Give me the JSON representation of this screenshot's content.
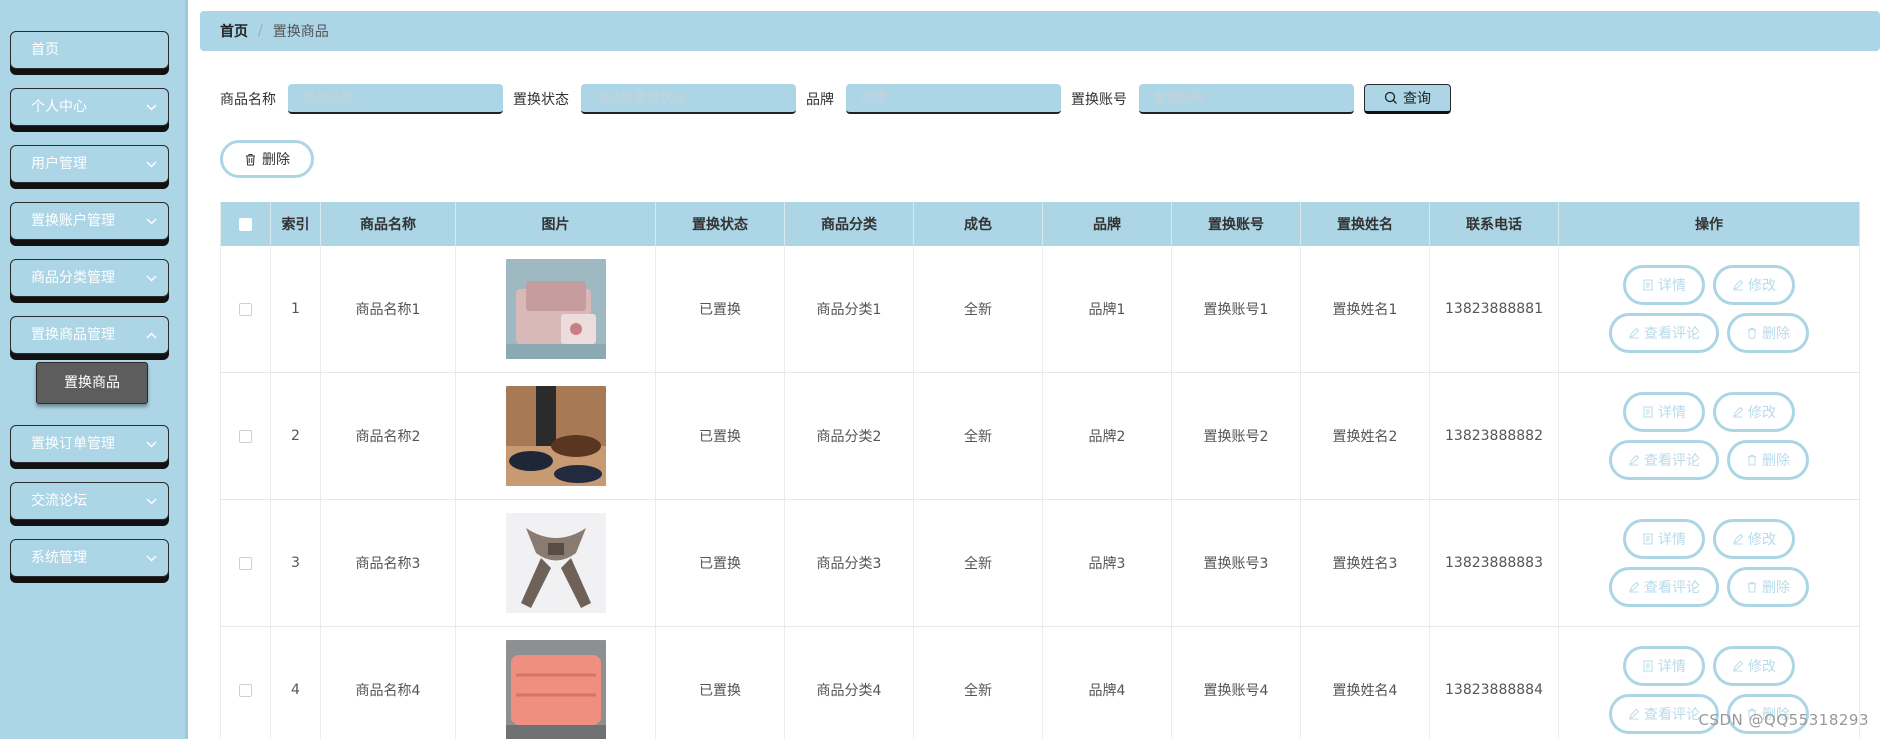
{
  "sidebar": {
    "items": [
      {
        "label": "首页"
      },
      {
        "label": "个人中心"
      },
      {
        "label": "用户管理"
      },
      {
        "label": "置换账户管理"
      },
      {
        "label": "商品分类管理"
      },
      {
        "label": "置换商品管理"
      },
      {
        "label": "置换订单管理"
      },
      {
        "label": "交流论坛"
      },
      {
        "label": "系统管理"
      }
    ],
    "sub_item": "置换商品"
  },
  "breadcrumb": {
    "home": "首页",
    "separator": "/",
    "current": "置换商品"
  },
  "search": {
    "name_label": "商品名称",
    "name_placeholder": "商品名称",
    "status_label": "置换状态",
    "status_placeholder": "请选择置换状态",
    "brand_label": "品牌",
    "brand_placeholder": "品牌",
    "account_label": "置换账号",
    "account_placeholder": "置换账号",
    "query_label": "查询"
  },
  "toolbar": {
    "delete_label": "删除"
  },
  "table": {
    "headers": {
      "index": "索引",
      "name": "商品名称",
      "image": "图片",
      "status": "置换状态",
      "category": "商品分类",
      "condition": "成色",
      "brand": "品牌",
      "account": "置换账号",
      "owner": "置换姓名",
      "phone": "联系电话",
      "actions": "操作"
    },
    "actions": {
      "detail": "详情",
      "edit": "修改",
      "review": "查看评论",
      "delete": "删除"
    },
    "rows": [
      {
        "index": "1",
        "name": "商品名称1",
        "status": "已置换",
        "category": "商品分类1",
        "condition": "全新",
        "brand": "品牌1",
        "account": "置换账号1",
        "owner": "置换姓名1",
        "phone": "13823888881"
      },
      {
        "index": "2",
        "name": "商品名称2",
        "status": "已置换",
        "category": "商品分类2",
        "condition": "全新",
        "brand": "品牌2",
        "account": "置换账号2",
        "owner": "置换姓名2",
        "phone": "13823888882"
      },
      {
        "index": "3",
        "name": "商品名称3",
        "status": "已置换",
        "category": "商品分类3",
        "condition": "全新",
        "brand": "品牌3",
        "account": "置换账号3",
        "owner": "置换姓名3",
        "phone": "13823888883"
      },
      {
        "index": "4",
        "name": "商品名称4",
        "status": "已置换",
        "category": "商品分类4",
        "condition": "全新",
        "brand": "品牌4",
        "account": "置换账号4",
        "owner": "置换姓名4",
        "phone": "13823888884"
      }
    ]
  },
  "watermark": "CSDN @QQ55318293",
  "colors": {
    "accent": "#acd5e6",
    "submenu": "#5d5d5d",
    "action_text": "#b8dbea"
  }
}
